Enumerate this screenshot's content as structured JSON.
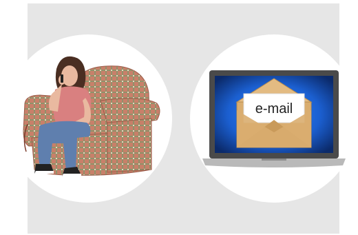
{
  "illustrations": {
    "left": {
      "icon": "person-on-phone-in-armchair"
    },
    "right": {
      "icon": "laptop-with-email-envelope",
      "envelope_label": "e-mail"
    }
  },
  "colors": {
    "page_background": "#ffffff",
    "panel_background": "#e6e6e6",
    "circle_background": "#ffffff",
    "armchair_base": "#c8806a",
    "armchair_check": "#7a9a6a",
    "shirt": "#d98080",
    "jeans": "#5f7fae",
    "hair": "#4a2e22",
    "skin": "#e9b9a0",
    "laptop_body": "#5a5a5a",
    "laptop_base": "#b9b9b9",
    "screen_blue": "#1b5fd0",
    "envelope": "#d9ad6f",
    "envelope_dark": "#c99a5a",
    "letter": "#ffffff"
  }
}
